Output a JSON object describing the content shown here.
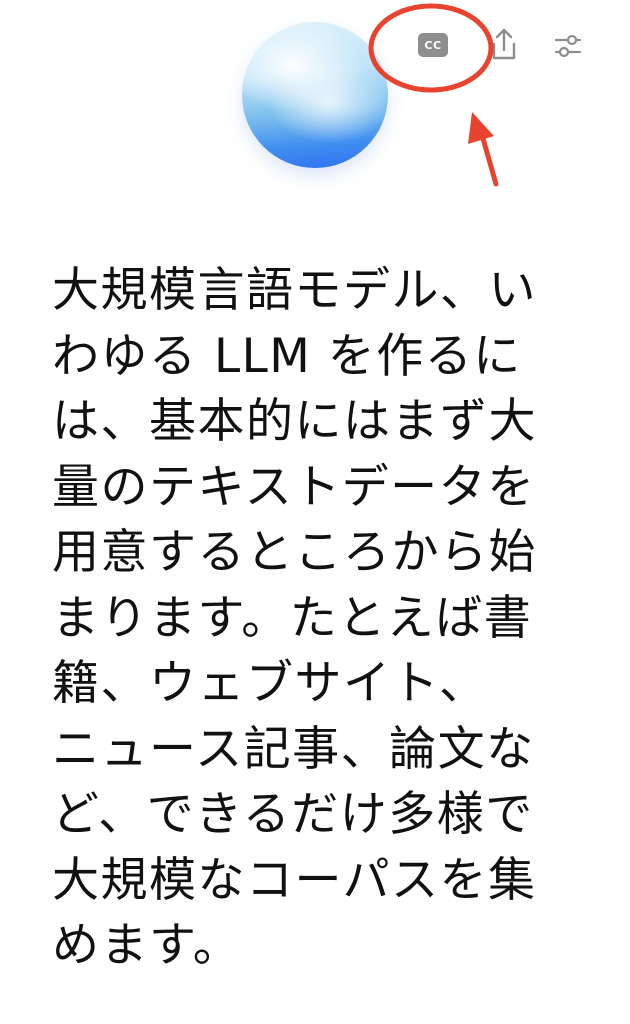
{
  "header": {
    "cc_label": "CC",
    "icons": {
      "captions": "closed-captions-icon",
      "share": "share-icon",
      "settings": "sliders-icon"
    }
  },
  "annotation": {
    "color": "#e8432e",
    "shape": "circle-with-arrow",
    "target": "closed-captions-icon"
  },
  "transcript": {
    "lines": [
      "大規模言語モデル、い",
      "わゆる LLM を作るに",
      "は、基本的にはまず大",
      "量のテキストデータを",
      "用意するところから始",
      "まります。たとえば書",
      "籍、ウェブサイト、",
      "ニュース記事、論文な",
      "ど、できるだけ多様で",
      "大規模なコーパスを集",
      "めます。"
    ]
  },
  "colors": {
    "icon_gray": "#8e8e8e",
    "text": "#111111",
    "annotation_red": "#e8432e"
  }
}
